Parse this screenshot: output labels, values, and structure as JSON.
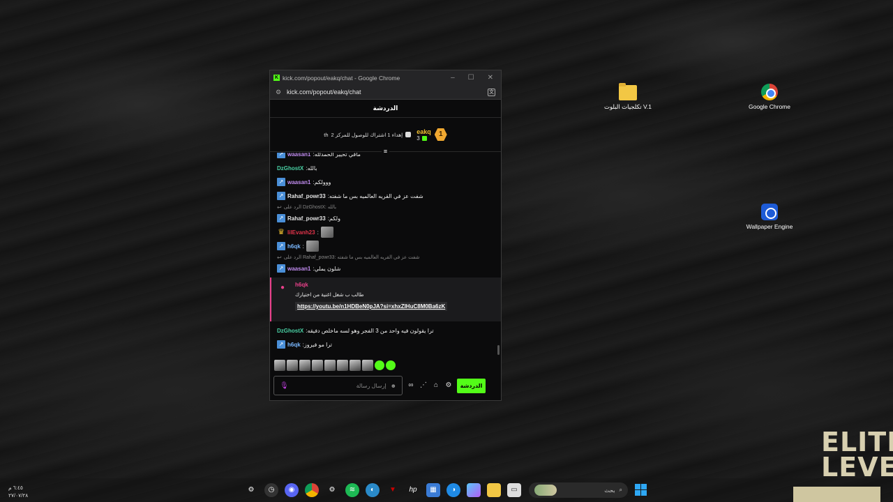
{
  "window": {
    "title": "kick.com/popout/eakq/chat - Google Chrome",
    "url": "kick.com/popout/eakq/chat",
    "controls": [
      "–",
      "☐",
      "✕"
    ]
  },
  "chat": {
    "header": "الدردشة",
    "goal": {
      "text": "إهداء 1 اشتراك للوصول للمركز 2",
      "suffix": "th",
      "user": "eakq",
      "count": "3",
      "rank": "1"
    },
    "messages": [
      {
        "badge": "k",
        "user": "waasan1",
        "color": "#c18cf0",
        "text": ":مافي تحيير الحمدلله",
        "kind": "msg"
      },
      {
        "badge": "",
        "user": "DzGhostX",
        "color": "#4ad1a5",
        "text": ":بالله",
        "kind": "msg"
      },
      {
        "badge": "k",
        "user": "waasan1",
        "color": "#c18cf0",
        "text": ":ووولكم",
        "kind": "msg"
      },
      {
        "badge": "k",
        "user": "Rahaf_powr33",
        "color": "#e4e4e4",
        "text": ":شفت عز في القريه العالميه بس ما شفته",
        "kind": "msg"
      },
      {
        "badge": "",
        "user": "",
        "color": "#888",
        "text": "الرد على DzGhostX: بالله",
        "kind": "reply"
      },
      {
        "badge": "k",
        "user": "Rahaf_powr33",
        "color": "#e4e4e4",
        "text": ":ولكم",
        "kind": "msg"
      },
      {
        "badge": "crown",
        "user": "lilEvanh23",
        "color": "#e2334a",
        "text": ":",
        "kind": "emote"
      },
      {
        "badge": "k",
        "user": "h6qk",
        "color": "#7ab8ff",
        "text": ":",
        "kind": "emote"
      },
      {
        "badge": "",
        "user": "",
        "color": "#888",
        "text": "الرد على Rahaf_powr33: شفت عز في القريه العالميه بس ما شفته",
        "kind": "reply"
      },
      {
        "badge": "k",
        "user": "waasan1",
        "color": "#c18cf0",
        "text": ":شلون يملي",
        "kind": "msg"
      }
    ],
    "pinned": {
      "user": "h6qk",
      "text": "طالب ب شغل اغنية من اختيارك",
      "link": "https://youtu.be/n1HDBeN0pJA?si=xhxZIHuC8M0Ba6zK"
    },
    "messages_after": [
      {
        "badge": "",
        "user": "DzGhostX",
        "color": "#4ad1a5",
        "text": ":ترا يقولون فيه واحد من 3 الفجر وهو لسه ماخلص دفيقه",
        "kind": "msg"
      },
      {
        "badge": "k",
        "user": "h6qk",
        "color": "#7ab8ff",
        "text": ":ترا مو فيروز",
        "kind": "msg"
      }
    ],
    "input": {
      "placeholder": "إرسال رسالة",
      "send_label": "الدردشة"
    }
  },
  "desktop": {
    "icons": [
      {
        "label": "تكلجيات البلوت V.1",
        "kind": "folder"
      },
      {
        "label": "Google Chrome",
        "kind": "chrome"
      },
      {
        "label": "Wallpaper Engine",
        "kind": "wallpaper-engine"
      }
    ],
    "logo_text": [
      "ELITE",
      "LEVEL"
    ]
  },
  "taskbar": {
    "clock_time": "٦:٤٥ م",
    "clock_date": "٢٧/٠٧/٢٨",
    "search_label": "بحث",
    "apps": [
      "settings-gear",
      "clock",
      "discord",
      "chrome",
      "settings",
      "spotify",
      "edge-dev",
      "mcafee",
      "hp",
      "store",
      "edge",
      "copilot",
      "explorer",
      "taskview"
    ]
  }
}
